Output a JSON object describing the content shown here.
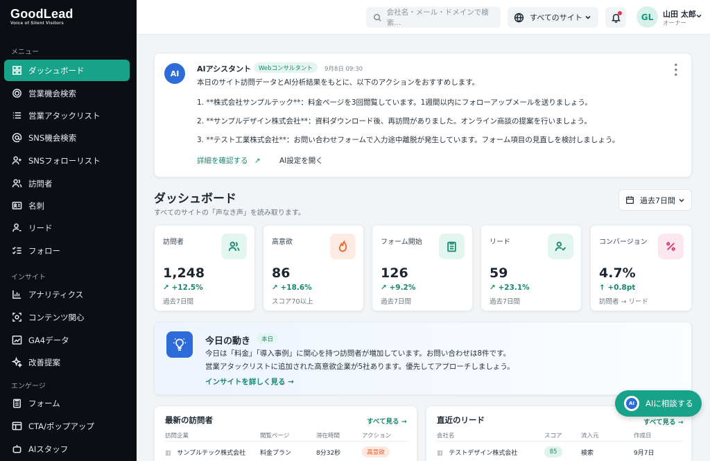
{
  "brand": {
    "name": "GoodLead",
    "tagline": "Voice of Silent Visitors"
  },
  "sidebar": {
    "sections": [
      "メニュー",
      "インサイト",
      "エンゲージ"
    ],
    "menu": [
      {
        "label": "ダッシュボード",
        "icon": "grid-icon"
      },
      {
        "label": "営業機会検索",
        "icon": "target-icon"
      },
      {
        "label": "営業アタックリスト",
        "icon": "list-icon"
      },
      {
        "label": "SNS機会検索",
        "icon": "at-icon"
      },
      {
        "label": "SNSフォローリスト",
        "icon": "user-plus-icon"
      },
      {
        "label": "訪問者",
        "icon": "users-icon"
      },
      {
        "label": "名刺",
        "icon": "id-card-icon"
      },
      {
        "label": "リード",
        "icon": "user-icon"
      },
      {
        "label": "フォロー",
        "icon": "checklist-icon"
      }
    ],
    "insight": [
      {
        "label": "アナリティクス",
        "icon": "bar-chart-icon"
      },
      {
        "label": "コンテンツ関心",
        "icon": "scan-icon"
      },
      {
        "label": "GA4データ",
        "icon": "line-chart-icon"
      },
      {
        "label": "改善提案",
        "icon": "sparkle-icon"
      }
    ],
    "engage": [
      {
        "label": "フォーム",
        "icon": "clipboard-icon"
      },
      {
        "label": "CTA/ポップアップ",
        "icon": "window-icon"
      },
      {
        "label": "AIスタッフ",
        "icon": "robot-icon"
      }
    ]
  },
  "topbar": {
    "search_placeholder": "会社名・メール・ドメインで検索...",
    "site_selector": "すべてのサイト",
    "user_name": "山田 太郎",
    "user_role": "オーナー",
    "avatar_initials": "GL"
  },
  "ai_card": {
    "avatar": "AI",
    "title": "AIアシスタント",
    "tag": "Webコンサルタント",
    "date": "9月8日 09:30",
    "intro": "本日のサイト訪問データとAI分析結果をもとに、以下のアクションをおすすめします。",
    "items": [
      "1. **株式会社サンプルテック**：料金ページを3回閲覧しています。1週間以内にフォローアップメールを送りましょう。",
      "2. **サンプルデザイン株式会社**：資料ダウンロード後、再訪問がありました。オンライン商談の提案を行いましょう。",
      "3. **テスト工業株式会社**：お問い合わせフォームで入力途中離脱が発生しています。フォーム項目の見直しを検討しましょう。"
    ],
    "link_details": "詳細を確認する",
    "link_settings": "AI設定を開く"
  },
  "dashboard": {
    "title": "ダッシュボード",
    "subtitle": "すべてのサイトの「声なき声」を読み取ります。",
    "period": "過去7日間"
  },
  "kpis": [
    {
      "label": "訪問者",
      "value": "1,248",
      "change": "+12.5%",
      "note": "過去7日間",
      "icon": "users-icon",
      "bg": "#e3f5ef",
      "fg": "#17876f",
      "arrow": "↗"
    },
    {
      "label": "高意欲",
      "value": "86",
      "change": "+18.6%",
      "note": "スコア70以上",
      "icon": "flame-icon",
      "bg": "#fdebe3",
      "fg": "#e8632b",
      "arrow": "↗"
    },
    {
      "label": "フォーム開始",
      "value": "126",
      "change": "+9.2%",
      "note": "過去7日間",
      "icon": "clipboard-icon",
      "bg": "#e3f5ef",
      "fg": "#17876f",
      "arrow": "↗"
    },
    {
      "label": "リード",
      "value": "59",
      "change": "+23.1%",
      "note": "過去7日間",
      "icon": "user-check-icon",
      "bg": "#e3f5ef",
      "fg": "#17876f",
      "arrow": "↗"
    },
    {
      "label": "コンバージョン",
      "value": "4.7%",
      "change": "+0.8pt",
      "note": "訪問者 → リード",
      "icon": "percent-icon",
      "bg": "#fde7ee",
      "fg": "#d9376b",
      "arrow": "↑"
    }
  ],
  "today": {
    "title": "今日の動き",
    "tag": "本日",
    "line1": "今日は「料金」「導入事例」に関心を持つ訪問者が増加しています。お問い合わせは8件です。",
    "line2": "営業アタックリストに追加された高意欲企業が5社あります。優先してアプローチしましょう。",
    "link": "インサイトを詳しく見る →"
  },
  "visitors": {
    "title": "最新の訪問者",
    "more": "すべて見る →",
    "columns": [
      "訪問企業",
      "閲覧ページ",
      "滞在時間",
      "アクション"
    ],
    "rows": [
      {
        "company": "サンプルテック株式会社",
        "page": "料金プラン",
        "time": "8分32秒",
        "action": "高意欲"
      }
    ]
  },
  "leads": {
    "title": "直近のリード",
    "more": "すべて見る →",
    "columns": [
      "会社名",
      "スコア",
      "流入元",
      "作成日"
    ],
    "rows": [
      {
        "company": "テストデザイン株式会社",
        "score": "85",
        "source": "検索",
        "date": "9月7日"
      }
    ]
  },
  "fab": {
    "icon_text": "AI",
    "label": "AIに相談する"
  },
  "colors": {
    "accent": "#17a289",
    "sidebar_bg": "#0b0f13",
    "ai_blue": "#2d6bd8"
  }
}
